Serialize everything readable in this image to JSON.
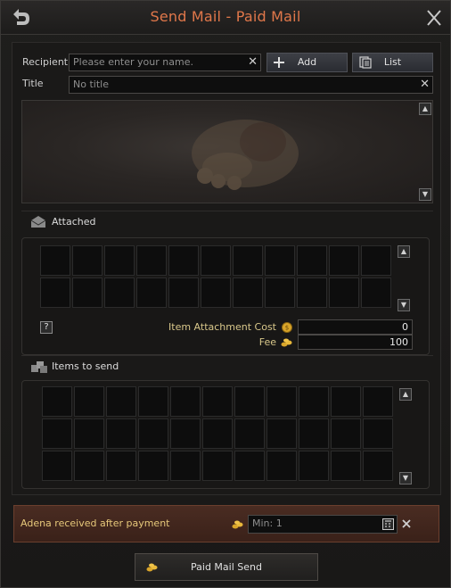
{
  "window": {
    "title": "Send Mail - Paid Mail"
  },
  "recipient": {
    "label": "Recipient",
    "placeholder": "Please enter your name.",
    "add_label": "Add",
    "list_label": "List"
  },
  "title_field": {
    "label": "Title",
    "placeholder": "No title"
  },
  "attached": {
    "title": "Attached",
    "item_attachment_cost_label": "Item Attachment Cost",
    "item_attachment_cost_value": "0",
    "fee_label": "Fee",
    "fee_value": "100"
  },
  "items_to_send": {
    "title": "Items to send"
  },
  "adena": {
    "label": "Adena received after payment",
    "placeholder": "Min: 1"
  },
  "send": {
    "label": "Paid Mail Send"
  },
  "help": {
    "label": "?"
  },
  "colors": {
    "title": "#e0774a",
    "adena_bg": "#4a2c22",
    "gold": "#e6c87a"
  }
}
